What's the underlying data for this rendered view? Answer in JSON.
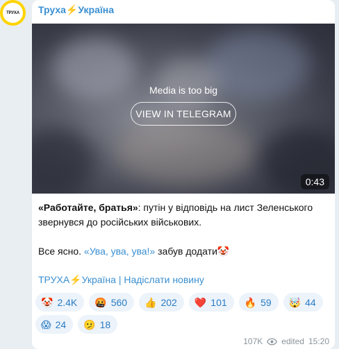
{
  "avatar": {
    "text": "ТРУХА"
  },
  "post": {
    "channel_name": "Труха⚡️Україна",
    "media": {
      "notice": "Media is too big",
      "button_label": "VIEW IN TELEGRAM",
      "duration": "0:43"
    },
    "text": {
      "bold_quote": "«Работайте, братья»",
      "line1_rest": ": путін у відповідь на лист Зеленського звернувся до російських військових.",
      "line2_start": "Все ясно. ",
      "line2_link": "«Ува, ува, ува!»",
      "line2_end": " забув додати🤡"
    },
    "footer_link": "ТРУХА⚡️Україна | Надіслати новину",
    "reactions": [
      {
        "emoji": "🤡",
        "count": "2.4K"
      },
      {
        "emoji": "🤬",
        "count": "560"
      },
      {
        "emoji": "👍",
        "count": "202"
      },
      {
        "emoji": "❤️",
        "count": "101"
      },
      {
        "emoji": "🔥",
        "count": "59"
      },
      {
        "emoji": "🤯",
        "count": "44"
      },
      {
        "emoji": "😱",
        "count": "24"
      },
      {
        "emoji": "🫤",
        "count": "18"
      }
    ],
    "meta": {
      "views": "107K",
      "edited": "edited",
      "time": "15:20"
    }
  },
  "colors": {
    "accent": "#3a8fd1",
    "avatar_ring": "#ffd400",
    "reaction_bg": "#ecf3fa"
  }
}
